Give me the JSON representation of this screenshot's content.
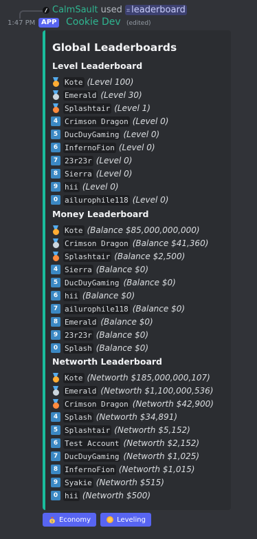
{
  "reply": {
    "user": "CalmSault",
    "used": "used",
    "command": "leaderboard",
    "command_prefix": "⌗"
  },
  "header": {
    "timestamp": "1:47 PM",
    "badge": "APP",
    "author": "Cookie Dev",
    "edited": "(edited)"
  },
  "embed": {
    "title": "Global Leaderboards",
    "accent": "#1abc9c",
    "sections": [
      {
        "title": "Level Leaderboard",
        "rows": [
          {
            "rank": 1,
            "icon": "gold-medal-icon",
            "name": "Kote",
            "detail": "(Level 100)"
          },
          {
            "rank": 2,
            "icon": "silver-medal-icon",
            "name": "Emerald",
            "detail": "(Level 30)"
          },
          {
            "rank": 3,
            "icon": "bronze-medal-icon",
            "name": "Splashtair",
            "detail": "(Level 1)"
          },
          {
            "rank": 4,
            "icon": "keycap-4-icon",
            "name": "Crimson Dragon",
            "detail": "(Level 0)"
          },
          {
            "rank": 5,
            "icon": "keycap-5-icon",
            "name": "DucDuyGaming",
            "detail": "(Level 0)"
          },
          {
            "rank": 6,
            "icon": "keycap-6-icon",
            "name": "InfernoFion",
            "detail": "(Level 0)"
          },
          {
            "rank": 7,
            "icon": "keycap-7-icon",
            "name": "23r23r",
            "detail": "(Level 0)"
          },
          {
            "rank": 8,
            "icon": "keycap-8-icon",
            "name": "Sierra",
            "detail": "(Level 0)"
          },
          {
            "rank": 9,
            "icon": "keycap-9-icon",
            "name": "hii",
            "detail": "(Level 0)"
          },
          {
            "rank": 10,
            "icon": "keycap-0-icon",
            "name": "ailurophile118",
            "detail": "(Level 0)"
          }
        ]
      },
      {
        "title": "Money Leaderboard",
        "rows": [
          {
            "rank": 1,
            "icon": "gold-medal-icon",
            "name": "Kote",
            "detail": "(Balance $85,000,000,000)"
          },
          {
            "rank": 2,
            "icon": "silver-medal-icon",
            "name": "Crimson Dragon",
            "detail": "(Balance $41,360)"
          },
          {
            "rank": 3,
            "icon": "bronze-medal-icon",
            "name": "Splashtair",
            "detail": "(Balance $2,500)"
          },
          {
            "rank": 4,
            "icon": "keycap-4-icon",
            "name": "Sierra",
            "detail": "(Balance $0)"
          },
          {
            "rank": 5,
            "icon": "keycap-5-icon",
            "name": "DucDuyGaming",
            "detail": "(Balance $0)"
          },
          {
            "rank": 6,
            "icon": "keycap-6-icon",
            "name": "hii",
            "detail": "(Balance $0)"
          },
          {
            "rank": 7,
            "icon": "keycap-7-icon",
            "name": "ailurophile118",
            "detail": "(Balance $0)"
          },
          {
            "rank": 8,
            "icon": "keycap-8-icon",
            "name": "Emerald",
            "detail": "(Balance $0)"
          },
          {
            "rank": 9,
            "icon": "keycap-9-icon",
            "name": "23r23r",
            "detail": "(Balance $0)"
          },
          {
            "rank": 10,
            "icon": "keycap-0-icon",
            "name": "Splash",
            "detail": "(Balance $0)"
          }
        ]
      },
      {
        "title": "Networth Leaderboard",
        "rows": [
          {
            "rank": 1,
            "icon": "gold-medal-icon",
            "name": "Kote",
            "detail": "(Networth $185,000,000,107)"
          },
          {
            "rank": 2,
            "icon": "silver-medal-icon",
            "name": "Emerald",
            "detail": "(Networth $1,100,000,536)"
          },
          {
            "rank": 3,
            "icon": "bronze-medal-icon",
            "name": "Crimson Dragon",
            "detail": "(Networth $42,900)"
          },
          {
            "rank": 4,
            "icon": "keycap-4-icon",
            "name": "Splash",
            "detail": "(Networth $34,891)"
          },
          {
            "rank": 5,
            "icon": "keycap-5-icon",
            "name": "Splashtair",
            "detail": "(Networth $5,152)"
          },
          {
            "rank": 6,
            "icon": "keycap-6-icon",
            "name": "Test Account",
            "detail": "(Networth $2,152)"
          },
          {
            "rank": 7,
            "icon": "keycap-7-icon",
            "name": "DucDuyGaming",
            "detail": "(Networth $1,025)"
          },
          {
            "rank": 8,
            "icon": "keycap-8-icon",
            "name": "InfernoFion",
            "detail": "(Networth $1,015)"
          },
          {
            "rank": 9,
            "icon": "keycap-9-icon",
            "name": "Syakie",
            "detail": "(Networth $515)"
          },
          {
            "rank": 10,
            "icon": "keycap-0-icon",
            "name": "hii",
            "detail": "(Networth $500)"
          }
        ]
      }
    ]
  },
  "buttons": [
    {
      "label": "Economy",
      "icon": "money-bag-icon"
    },
    {
      "label": "Leveling",
      "icon": "coin-icon"
    }
  ]
}
